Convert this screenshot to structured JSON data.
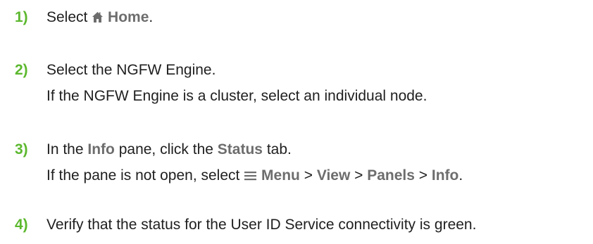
{
  "steps": [
    {
      "number": "1)",
      "line1": {
        "pre": "Select ",
        "icon": "home-icon",
        "ui": "Home",
        "post": "."
      }
    },
    {
      "number": "2)",
      "line1": "Select the NGFW Engine.",
      "line2": "If the NGFW Engine is a cluster, select an individual node."
    },
    {
      "number": "3)",
      "line1": {
        "t1": "In the ",
        "ui1": "Info",
        "t2": " pane, click the ",
        "ui2": "Status",
        "t3": " tab."
      },
      "line2": {
        "t1": "If the pane is not open, select ",
        "icon": "menu-icon",
        "ui1": "Menu",
        "sep1": " > ",
        "ui2": "View",
        "sep2": " > ",
        "ui3": "Panels",
        "sep3": " > ",
        "ui4": "Info",
        "t2": "."
      }
    },
    {
      "number": "4)",
      "line1": "Verify that the status for the User ID Service connectivity is green."
    }
  ],
  "colors": {
    "step_number": "#5cb82e",
    "ui_term": "#6d6d6d",
    "body_text": "#1f1f1f"
  }
}
